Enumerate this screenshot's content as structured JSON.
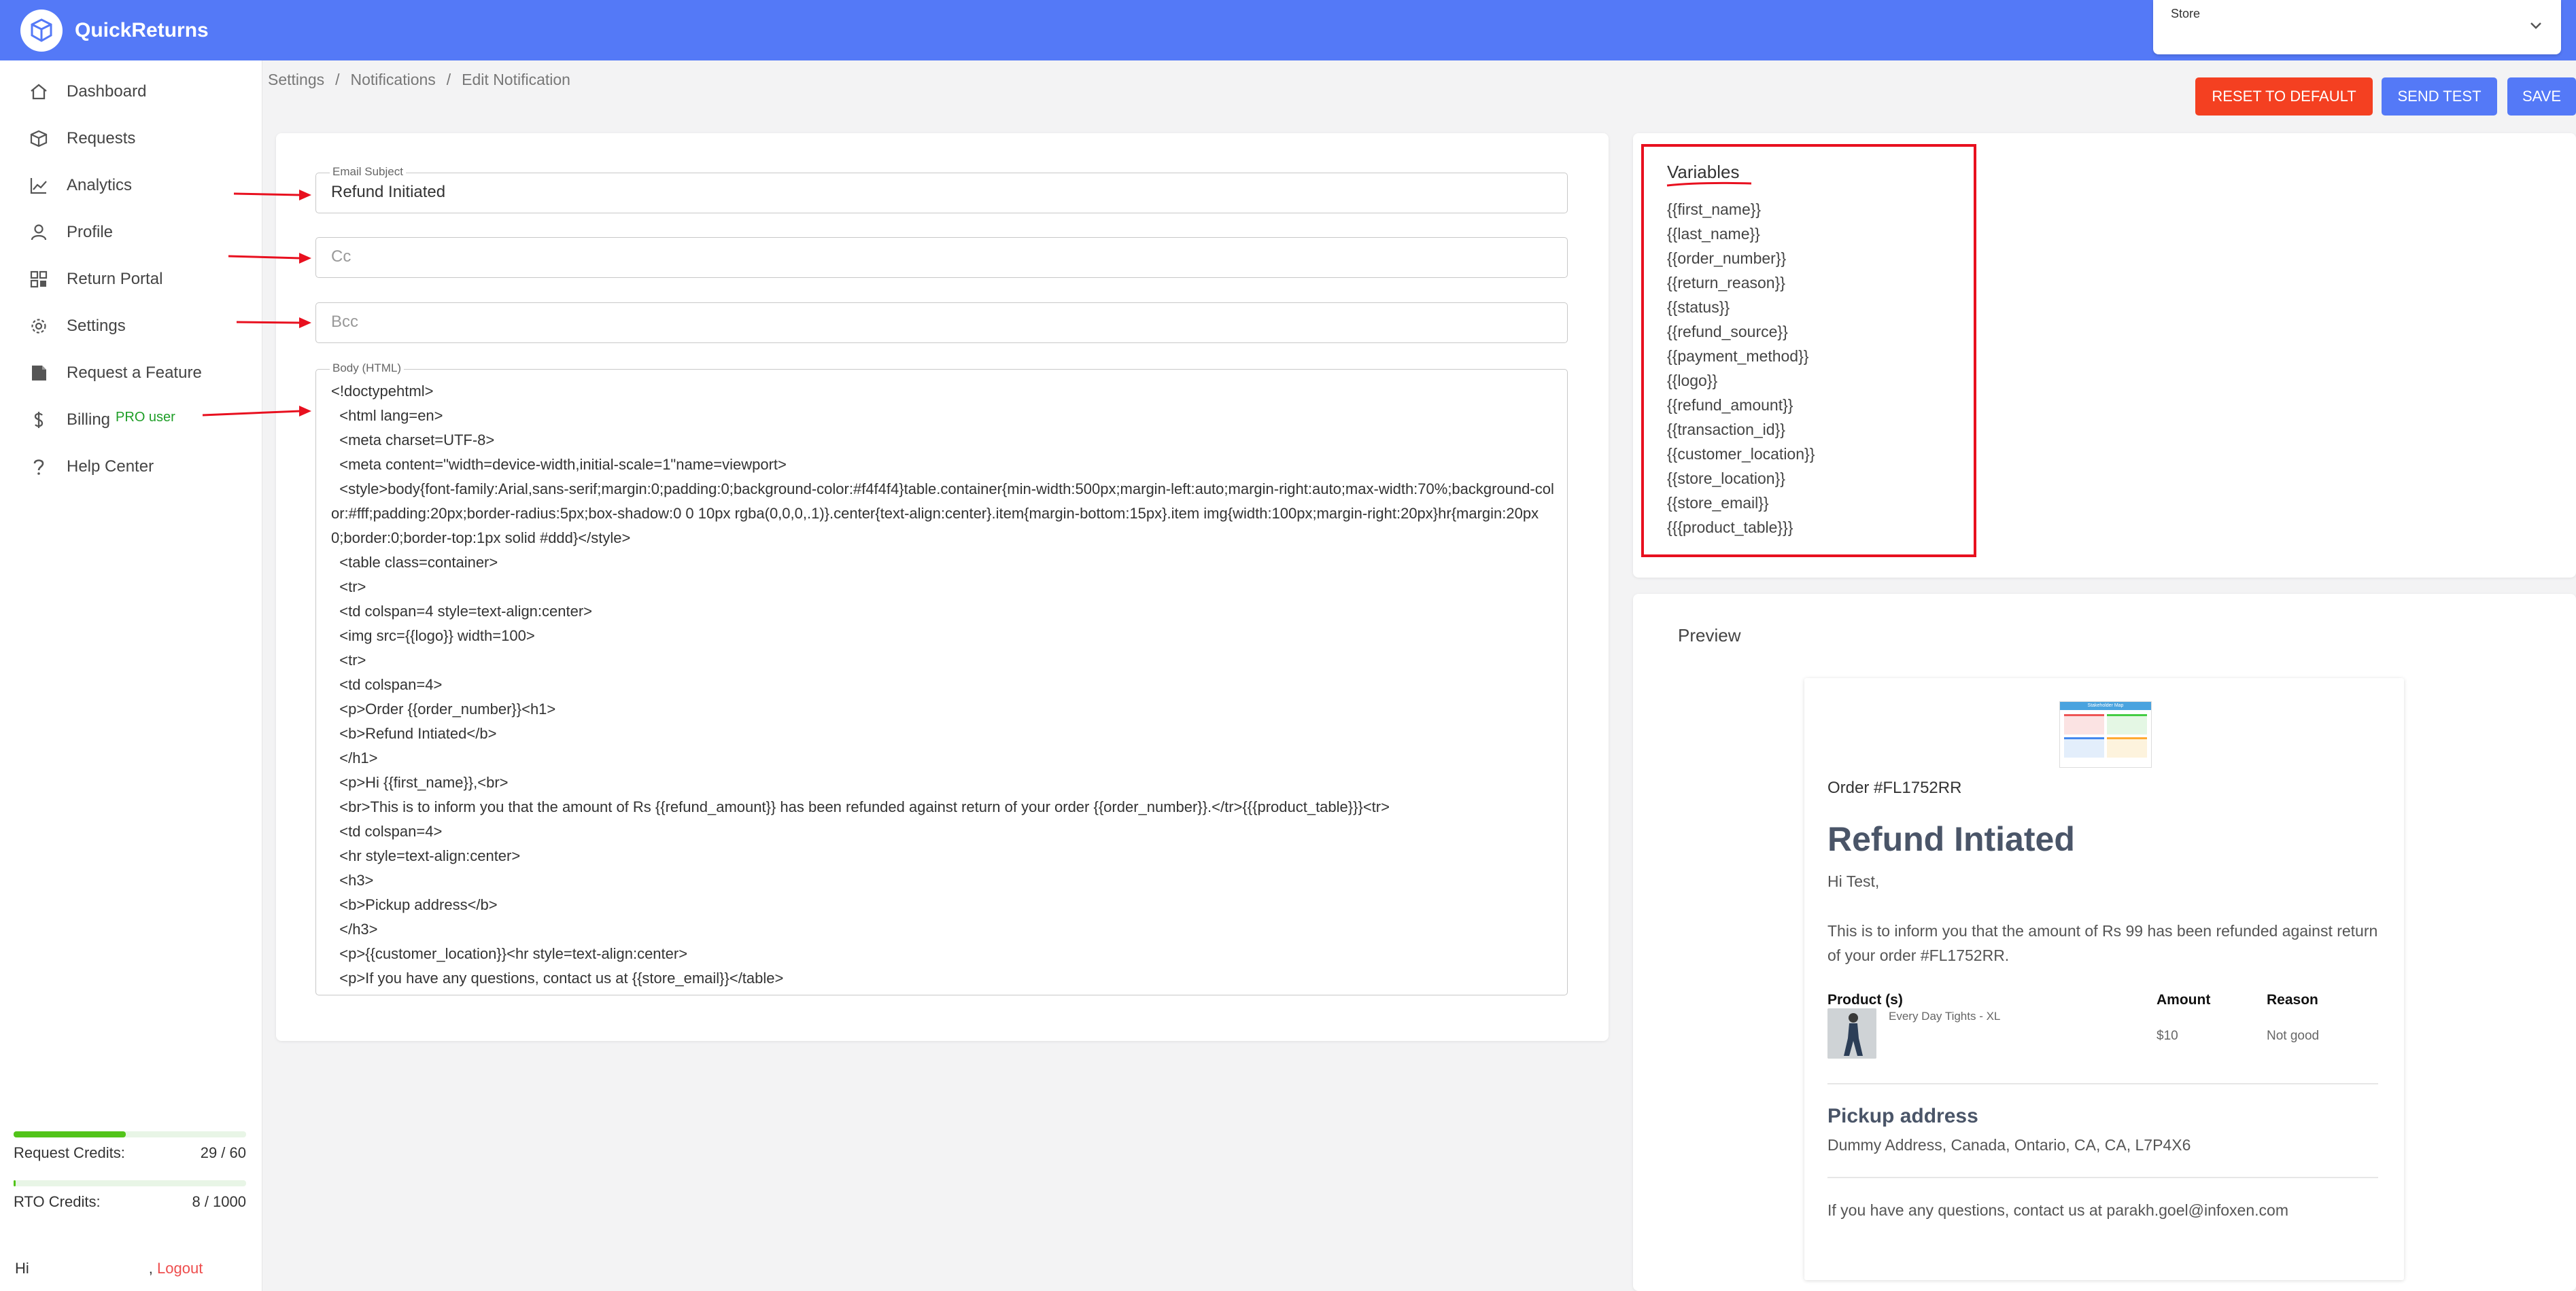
{
  "app": {
    "name": "QuickReturns"
  },
  "store_select": {
    "label": "Store"
  },
  "nav": {
    "items": [
      {
        "label": "Dashboard",
        "icon": "home-icon"
      },
      {
        "label": "Requests",
        "icon": "box-icon"
      },
      {
        "label": "Analytics",
        "icon": "chart-line-icon"
      },
      {
        "label": "Profile",
        "icon": "user-icon"
      },
      {
        "label": "Return Portal",
        "icon": "grid-icon"
      },
      {
        "label": "Settings",
        "icon": "gear-icon"
      },
      {
        "label": "Request a Feature",
        "icon": "note-icon"
      },
      {
        "label": "Billing",
        "icon": "dollar-icon",
        "badge": "PRO user"
      },
      {
        "label": "Help Center",
        "icon": "question-icon"
      }
    ]
  },
  "credits": {
    "request": {
      "label": "Request Credits:",
      "value": "29 / 60",
      "fraction": 0.483
    },
    "rto": {
      "label": "RTO Credits:",
      "value": "8 / 1000",
      "fraction": 0.008
    }
  },
  "user": {
    "greeting": "Hi",
    "separator": ",",
    "logout": "Logout"
  },
  "breadcrumb": [
    "Settings",
    "/",
    "Notifications",
    "/",
    "Edit Notification"
  ],
  "toolbar": {
    "reset": "RESET TO DEFAULT",
    "send_test": "SEND TEST",
    "save": "SAVE"
  },
  "form": {
    "subject_label": "Email Subject",
    "subject_value": "Refund Initiated",
    "cc_placeholder": "Cc",
    "bcc_placeholder": "Bcc",
    "body_label": "Body (HTML)",
    "body_lines": [
      "<!doctypehtml>",
      "  <html lang=en>",
      "  <meta charset=UTF-8>",
      "  <meta content=\"width=device-width,initial-scale=1\"name=viewport>",
      "  <style>body{font-family:Arial,sans-serif;margin:0;padding:0;background-color:#f4f4f4}table.container{min-width:500px;margin-left:auto;margin-right:auto;max-width:70%;background-color:#fff;padding:20px;border-radius:5px;box-shadow:0 0 10px rgba(0,0,0,.1)}.center{text-align:center}.item{margin-bottom:15px}.item img{width:100px;margin-right:20px}hr{margin:20px 0;border:0;border-top:1px solid #ddd}</style>",
      "  <table class=container>",
      "  <tr>",
      "  <td colspan=4 style=text-align:center>",
      "  <img src={{logo}} width=100>",
      "  <tr>",
      "  <td colspan=4>",
      "  <p>Order {{order_number}}<h1>",
      "  <b>Refund Intiated</b>",
      "  </h1>",
      "  <p>Hi {{first_name}},<br>",
      "  <br>This is to inform you that the amount of Rs {{refund_amount}} has been refunded against return of your order {{order_number}}.</tr>{{{product_table}}}<tr>",
      "  <td colspan=4>",
      "  <hr style=text-align:center>",
      "  <h3>",
      "  <b>Pickup address</b>",
      "  </h3>",
      "  <p>{{customer_location}}<hr style=text-align:center>",
      "  <p>If you have any questions, contact us at {{store_email}}</table>"
    ]
  },
  "variables": {
    "title": "Variables",
    "items": [
      "{{first_name}}",
      "{{last_name}}",
      "{{order_number}}",
      "{{return_reason}}",
      "{{status}}",
      "{{refund_source}}",
      "{{payment_method}}",
      "{{logo}}",
      "{{refund_amount}}",
      "{{transaction_id}}",
      "{{customer_location}}",
      "{{store_location}}",
      "{{store_email}}",
      "{{{product_table}}}"
    ]
  },
  "preview": {
    "title": "Preview",
    "logo_title": "Stakeholder Map",
    "order": "Order #FL1752RR",
    "heading": "Refund Intiated",
    "greeting": "Hi Test,",
    "body": "This is to inform you that the amount of Rs 99 has been refunded against return of your order #FL1752RR.",
    "table": {
      "headers": [
        "Product (s)",
        "Amount",
        "Reason"
      ],
      "row": {
        "product": "Every Day Tights - XL",
        "amount": "$10",
        "reason": "Not good"
      }
    },
    "pickup_title": "Pickup address",
    "pickup_address": "Dummy Address, Canada, Ontario, CA, CA, L7P4X6",
    "footer": "If you have any questions, contact us at parakh.goel@infoxen.com"
  },
  "colors": {
    "primary": "#5479f7",
    "danger": "#f44021",
    "annotation": "#e8101f",
    "success": "#52c41a"
  }
}
